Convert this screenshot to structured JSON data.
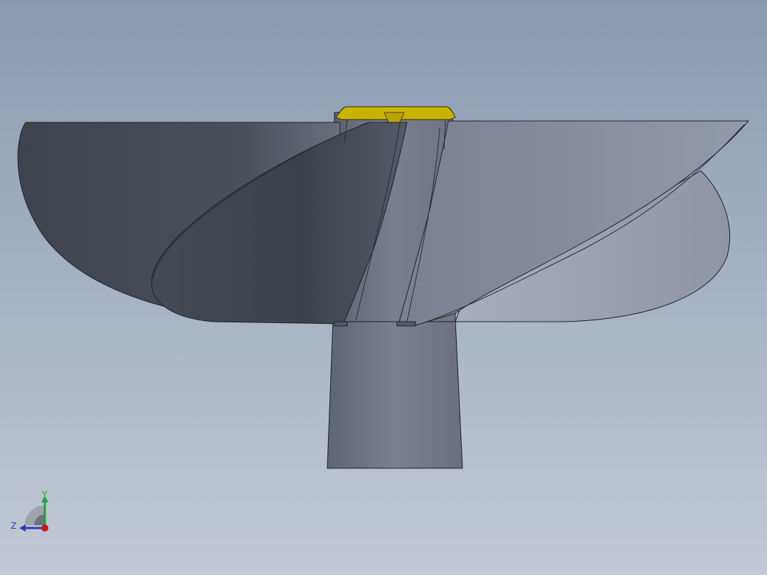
{
  "viewport": {
    "background_top": "#8a9bb0",
    "background_bottom": "#c3c9d5"
  },
  "model": {
    "name": "propeller",
    "part_color": "#6b7180",
    "highlight_color": "#c8b400"
  },
  "triad": {
    "y_label": "Y",
    "z_label": "Z",
    "y_color": "#1fa33a",
    "z_color": "#2a3db0",
    "origin_color": "#d01818"
  }
}
